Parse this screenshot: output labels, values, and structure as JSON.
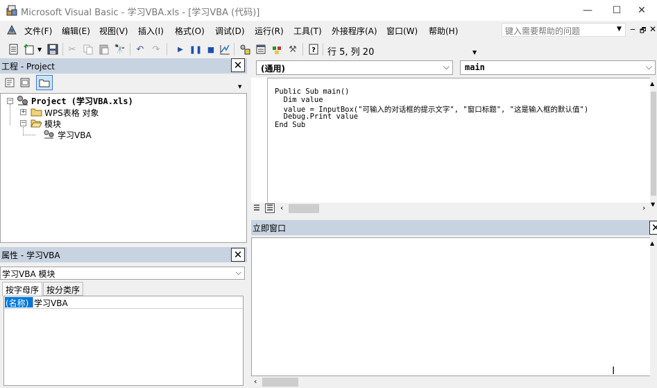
{
  "window": {
    "title": "Microsoft Visual Basic - 学习VBA.xls - [学习VBA (代码)]",
    "controls": {
      "minimize": "—",
      "maximize": "☐",
      "close": "✕"
    }
  },
  "menu": {
    "items": [
      "文件(F)",
      "编辑(E)",
      "视图(V)",
      "插入(I)",
      "格式(O)",
      "调试(D)",
      "运行(R)",
      "工具(T)",
      "外接程序(A)",
      "窗口(W)",
      "帮助(H)"
    ],
    "help_placeholder": "键入需要帮助的问题",
    "mdi": {
      "minimize": "‒",
      "restore": "🗗",
      "close": "✕"
    }
  },
  "toolbar": {
    "status": "行 5, 列 20"
  },
  "project_pane": {
    "title": "工程 - Project",
    "tree": {
      "root": "Project (学习VBA.xls)",
      "folder1": "WPS表格 对象",
      "folder2": "模块",
      "module": "学习VBA"
    }
  },
  "properties_pane": {
    "title": "属性 - 学习VBA",
    "object": "学习VBA 模块",
    "tabs": [
      "按字母序",
      "按分类序"
    ],
    "rows": [
      {
        "name": "(名称)",
        "value": "学习VBA"
      }
    ]
  },
  "code_window": {
    "object_combo": "(通用)",
    "proc_combo": "main",
    "lines": [
      "Public Sub main()",
      "  Dim value",
      "  value = InputBox(\"可输入的对话框的提示文字\", \"窗口标题\", \"这是输入框的默认值\")",
      "  Debug.Print value",
      "End Sub"
    ]
  },
  "immediate_window": {
    "title": "立即窗口"
  },
  "colors": {
    "pane_header": "#c7d3e0",
    "selection": "#0078d7"
  }
}
